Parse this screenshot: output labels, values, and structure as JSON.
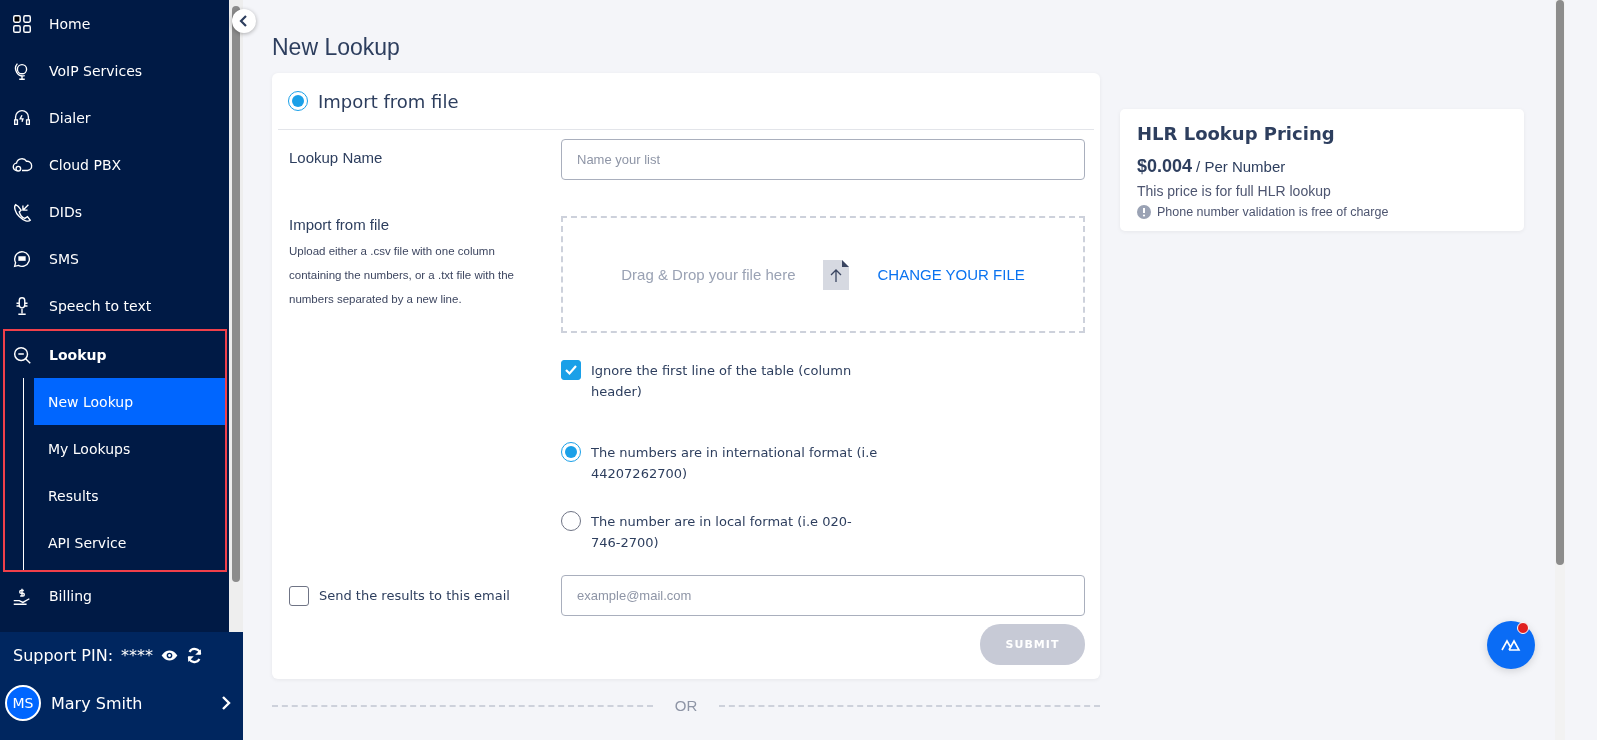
{
  "sidebar": {
    "items": [
      {
        "label": "Home"
      },
      {
        "label": "VoIP Services"
      },
      {
        "label": "Dialer"
      },
      {
        "label": "Cloud PBX"
      },
      {
        "label": "DIDs"
      },
      {
        "label": "SMS"
      },
      {
        "label": "Speech to text"
      },
      {
        "label": "Lookup",
        "expanded": true,
        "children": [
          {
            "label": "New Lookup",
            "selected": true
          },
          {
            "label": "My Lookups",
            "selected": false
          },
          {
            "label": "Results",
            "selected": false
          },
          {
            "label": "API Service",
            "selected": false
          }
        ]
      },
      {
        "label": "Billing"
      }
    ]
  },
  "support": {
    "label": "Support PIN:",
    "value": "****"
  },
  "user": {
    "initials": "MS",
    "name": "Mary Smith"
  },
  "page_title": "New Lookup",
  "form": {
    "source": {
      "label": "Import from file",
      "selected": true
    },
    "lookup_name": {
      "label": "Lookup Name",
      "placeholder": "Name your list"
    },
    "import": {
      "label": "Import from file",
      "help": "Upload either a .csv file with one column containing the numbers, or a .txt file with the numbers separated by a new line.",
      "drop_text": "Drag & Drop your file here",
      "link": "CHANGE YOUR FILE"
    },
    "ignore_header": {
      "label": "Ignore the first line of the table (column header)",
      "checked": true
    },
    "formats": [
      {
        "label": "The numbers are in international format (i.e 44207262700)",
        "selected": true
      },
      {
        "label": "The number are in local format (i.e 020-746-2700)",
        "selected": false
      }
    ],
    "email": {
      "label": "Send the results to this email",
      "checked": false,
      "placeholder": "example@mail.com"
    },
    "submit": {
      "label": "SUBMIT",
      "disabled": true
    }
  },
  "separator": "OR",
  "pricing": {
    "title": "HLR Lookup Pricing",
    "price": "$0.004",
    "unit": "/ Per Number",
    "note": "This price is for full HLR lookup",
    "info": "Phone number validation is free of charge"
  }
}
